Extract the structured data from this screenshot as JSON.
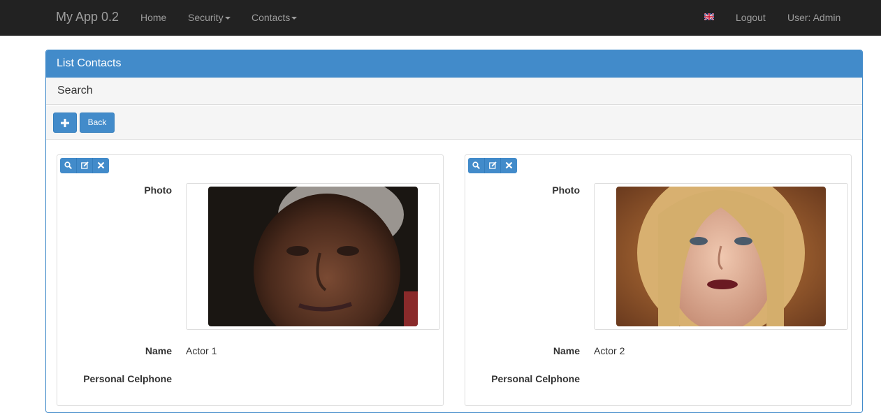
{
  "navbar": {
    "brand": "My App 0.2",
    "items": [
      {
        "label": "Home"
      },
      {
        "label": "Security"
      },
      {
        "label": "Contacts"
      }
    ],
    "language_icon": "uk-flag-icon",
    "logout": "Logout",
    "user": "User: Admin"
  },
  "panel": {
    "title": "List Contacts",
    "search_label": "Search",
    "toolbar": {
      "add_icon": "plus-icon",
      "back_label": "Back"
    }
  },
  "contacts": [
    {
      "labels": {
        "photo": "Photo",
        "name": "Name",
        "phone": "Personal Celphone"
      },
      "name": "Actor 1",
      "phone": ""
    },
    {
      "labels": {
        "photo": "Photo",
        "name": "Name",
        "phone": "Personal Celphone"
      },
      "name": "Actor 2",
      "phone": ""
    }
  ],
  "colors": {
    "primary": "#428bca",
    "navbar": "#222222"
  }
}
